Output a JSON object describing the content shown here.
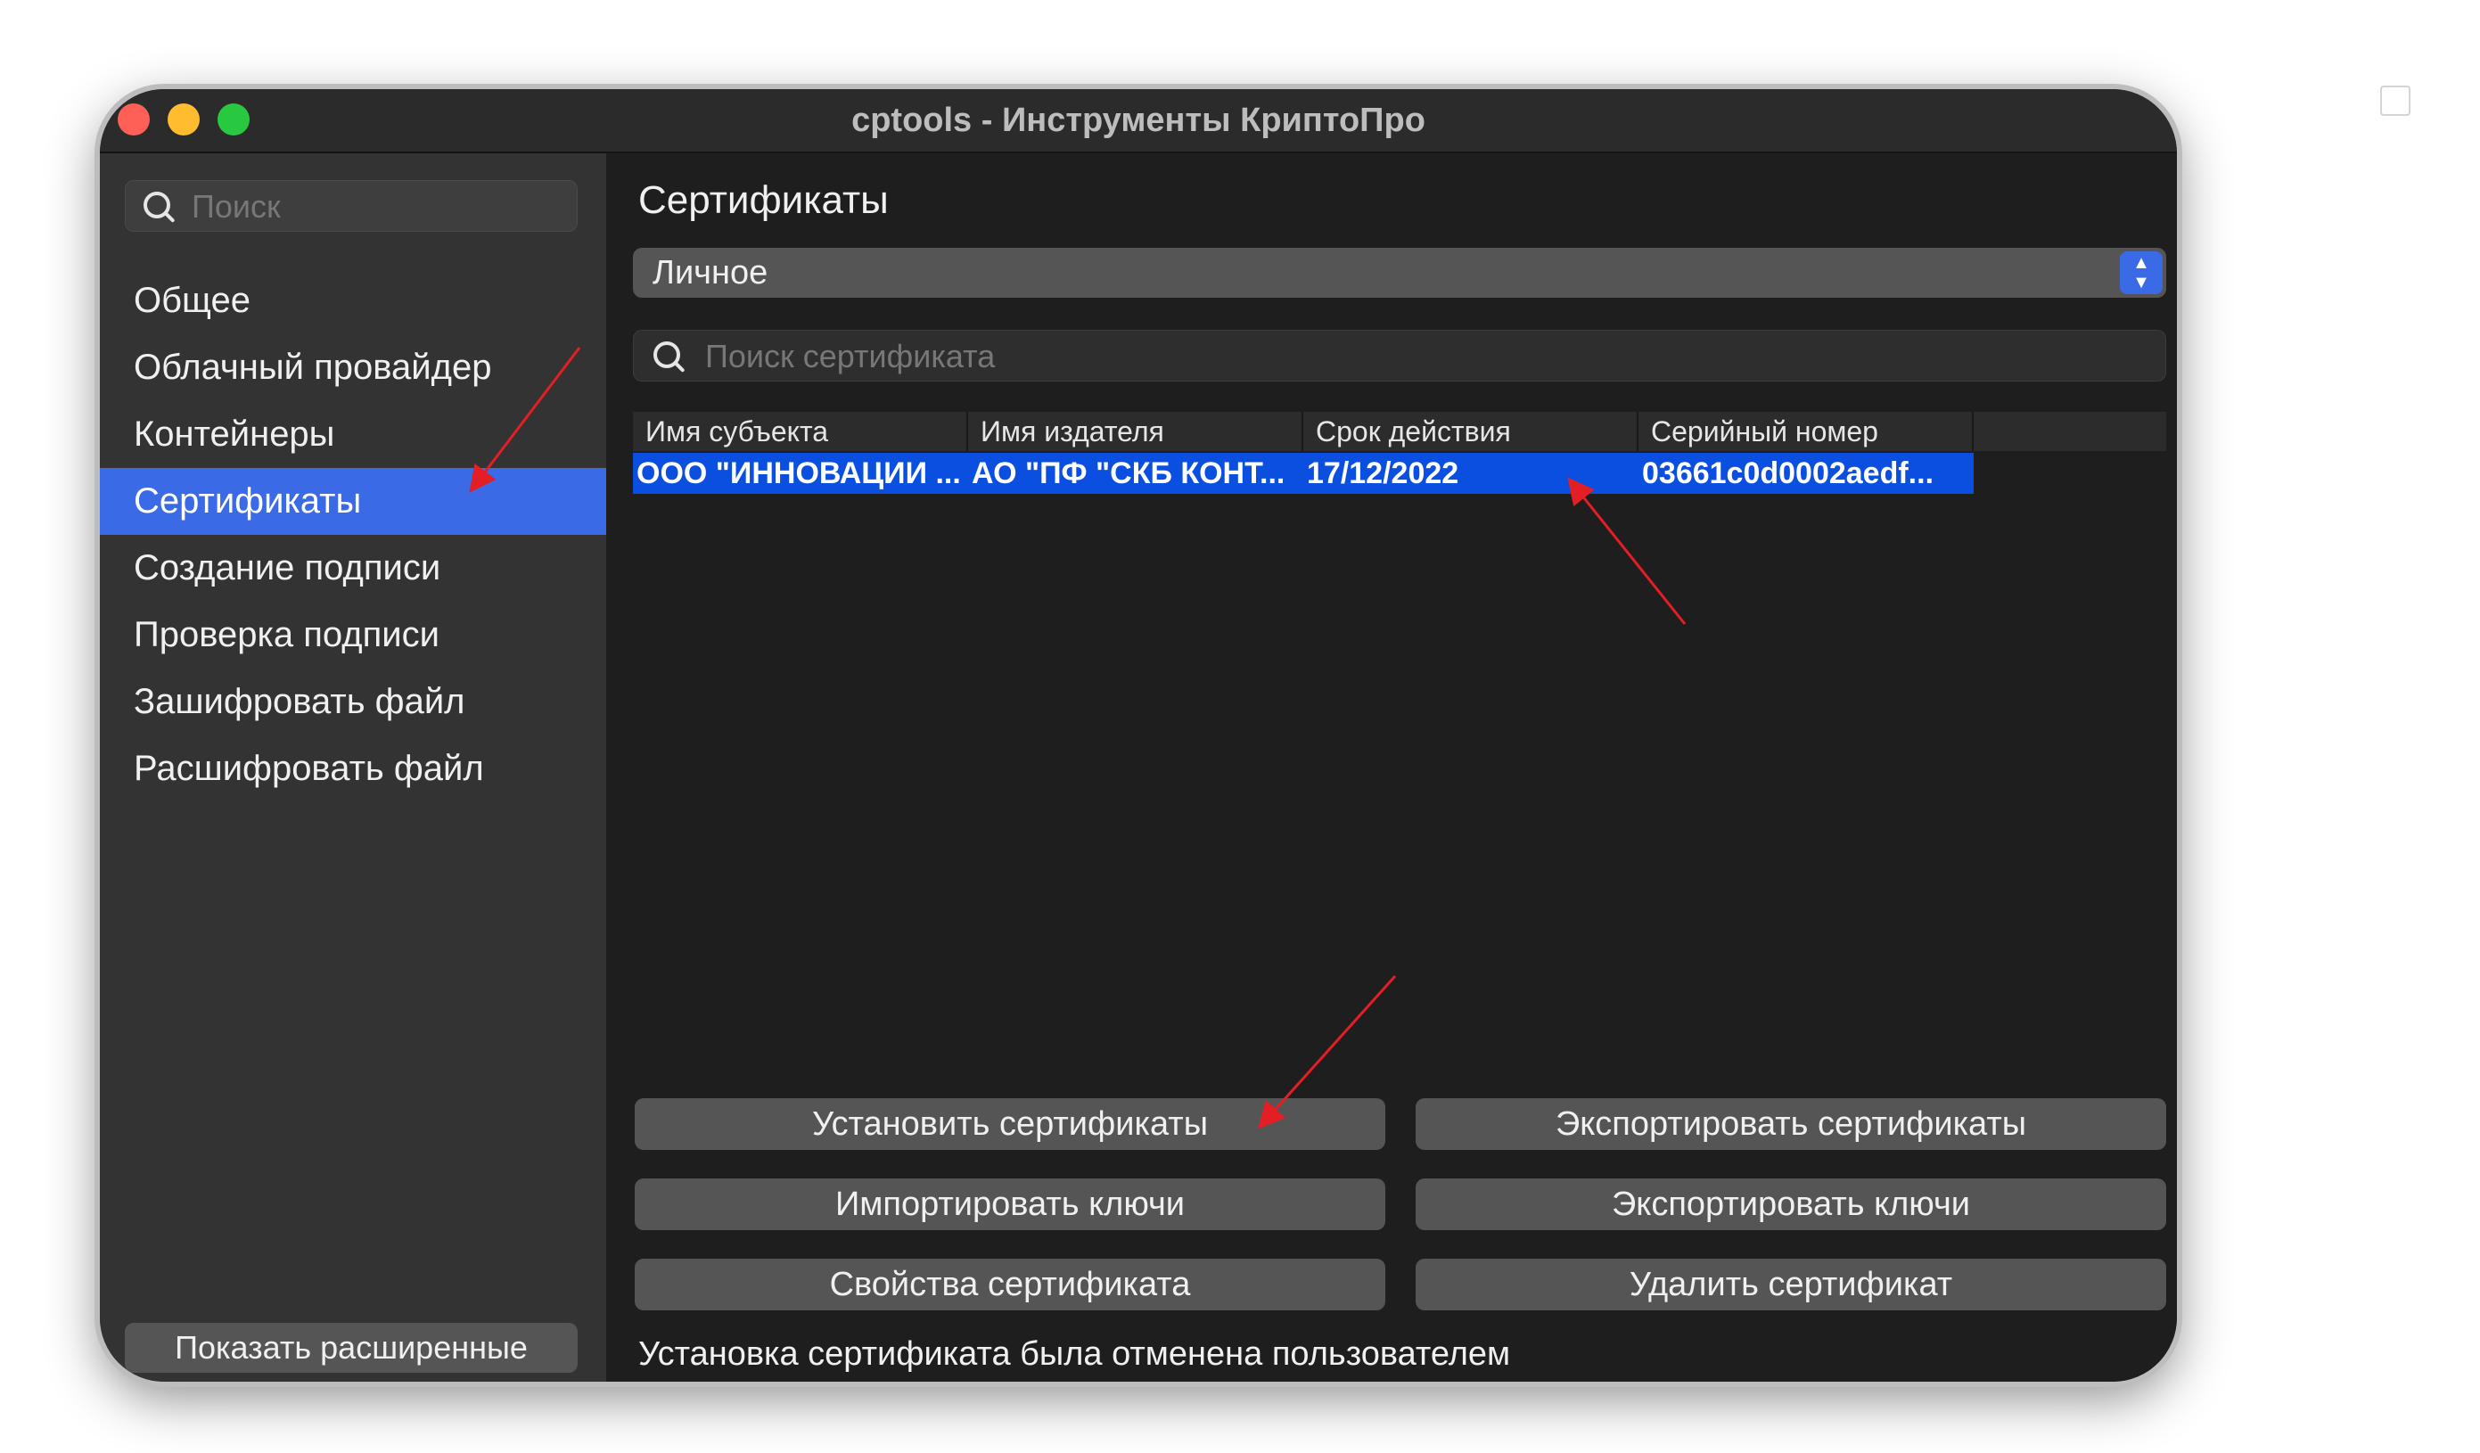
{
  "window": {
    "title": "cptools - Инструменты КриптоПро",
    "traffic_lights": [
      "close",
      "minimize",
      "maximize"
    ]
  },
  "sidebar": {
    "search_placeholder": "Поиск",
    "items": [
      {
        "label": "Общее",
        "active": false
      },
      {
        "label": "Облачный провайдер",
        "active": false
      },
      {
        "label": "Контейнеры",
        "active": false
      },
      {
        "label": "Сертификаты",
        "active": true
      },
      {
        "label": "Создание подписи",
        "active": false
      },
      {
        "label": "Проверка подписи",
        "active": false
      },
      {
        "label": "Зашифровать файл",
        "active": false
      },
      {
        "label": "Расшифровать файл",
        "active": false
      }
    ],
    "show_advanced_label": "Показать расширенные"
  },
  "main": {
    "title": "Сертификаты",
    "store_select_value": "Личное",
    "cert_search_placeholder": "Поиск сертификата",
    "table": {
      "columns": [
        "Имя субъекта",
        "Имя издателя",
        "Срок действия",
        "Серийный номер"
      ],
      "rows": [
        {
          "subject": "ООО \"ИННОВАЦИИ ...",
          "issuer": "АО \"ПФ \"СКБ КОНТ...",
          "expires": "17/12/2022",
          "serial": "03661c0d0002aedf...",
          "selected": true
        }
      ]
    },
    "buttons": {
      "install_certs": "Установить сертификаты",
      "export_certs": "Экспортировать сертификаты",
      "import_keys": "Импортировать ключи",
      "export_keys": "Экспортировать ключи",
      "cert_properties": "Свойства сертификата",
      "delete_cert": "Удалить сертификат"
    },
    "status": "Установка сертификата была отменена пользователем"
  },
  "colors": {
    "selection": "#3b6ae6",
    "row_selection": "#0a4fe0",
    "annotation_arrow": "#e31e24"
  }
}
